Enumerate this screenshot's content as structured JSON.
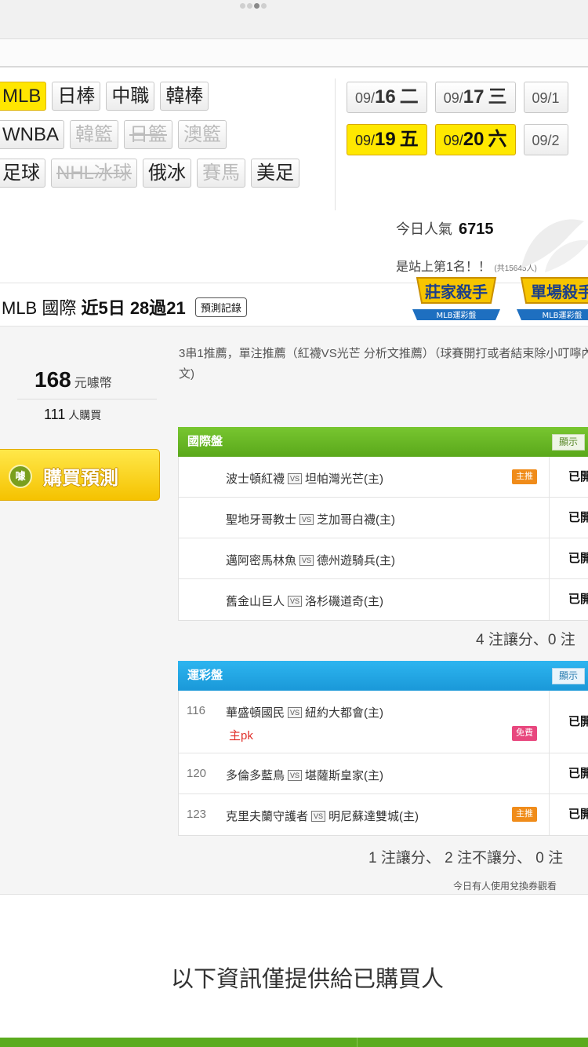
{
  "sport_tabs": {
    "row1": [
      {
        "label": "MLB",
        "state": "active"
      },
      {
        "label": "日棒",
        "state": "normal"
      },
      {
        "label": "中職",
        "state": "normal"
      },
      {
        "label": "韓棒",
        "state": "normal"
      }
    ],
    "row2": [
      {
        "label": "WNBA",
        "state": "normal"
      },
      {
        "label": "韓籃",
        "state": "disabled"
      },
      {
        "label": "日籃",
        "state": "strike"
      },
      {
        "label": "澳籃",
        "state": "disabled"
      }
    ],
    "row3": [
      {
        "label": "足球",
        "state": "normal"
      },
      {
        "label": "NHL冰球",
        "state": "strike"
      },
      {
        "label": "俄冰",
        "state": "normal"
      },
      {
        "label": "賽馬",
        "state": "disabled"
      },
      {
        "label": "美足",
        "state": "normal"
      }
    ]
  },
  "dates": {
    "row1": [
      {
        "md": "09/",
        "day": "16",
        "wd": "二",
        "active": false
      },
      {
        "md": "09/",
        "day": "17",
        "wd": "三",
        "active": false
      },
      {
        "md": "09/1",
        "day": "",
        "wd": "",
        "active": false
      }
    ],
    "row2": [
      {
        "md": "09/",
        "day": "19",
        "wd": "五",
        "active": true
      },
      {
        "md": "09/",
        "day": "20",
        "wd": "六",
        "active": true
      },
      {
        "md": "09/2",
        "day": "",
        "wd": "",
        "active": false
      }
    ]
  },
  "popularity": {
    "label": "今日人氣",
    "value": "6715"
  },
  "rank": {
    "text": "是站上第1名！！",
    "note": "(共15645人)"
  },
  "record": {
    "prefix": "MLB 國際 ",
    "bold": "近5日 28過21",
    "button": "預測記錄"
  },
  "badges": {
    "badge1_title": "莊家殺手",
    "badge1_sub": "MLB運彩盤",
    "badge2_title": "單場殺手",
    "badge2_sub": "MLB運彩盤"
  },
  "purchase": {
    "price": "168",
    "price_unit": "元噱幣",
    "buyers": "111",
    "buyers_unit": "人購買",
    "coin_label": "噱",
    "buy_button": "購買預測"
  },
  "description": "3串1推薦，單注推薦（紅襪VS光芒 分析文推薦）（球賽開打或者結束除小叮嚀內文)",
  "intl_table": {
    "title": "國際盤",
    "show_label": "顯示",
    "rows": [
      {
        "num": "",
        "away": "波士頓紅襪",
        "home": "坦帕灣光芒(主)",
        "sub": "",
        "tag": "主推",
        "tag_type": "main",
        "status": "已開"
      },
      {
        "num": "",
        "away": "聖地牙哥教士",
        "home": "芝加哥白襪(主)",
        "sub": "",
        "tag": "",
        "tag_type": "",
        "status": "已開"
      },
      {
        "num": "",
        "away": "邁阿密馬林魚",
        "home": "德州遊騎兵(主)",
        "sub": "",
        "tag": "",
        "tag_type": "",
        "status": "已開"
      },
      {
        "num": "",
        "away": "舊金山巨人",
        "home": "洛杉磯道奇(主)",
        "sub": "",
        "tag": "",
        "tag_type": "",
        "status": "已開"
      }
    ],
    "summary": "4 注讓分、0 注"
  },
  "sports_lottery_table": {
    "title": "運彩盤",
    "show_label": "顯示",
    "rows": [
      {
        "num": "116",
        "away": "華盛頓國民",
        "home": "紐約大都會(主)",
        "sub": "主pk",
        "tag": "免費",
        "tag_type": "free",
        "status": "已開"
      },
      {
        "num": "120",
        "away": "多倫多藍鳥",
        "home": "堪薩斯皇家(主)",
        "sub": "",
        "tag": "",
        "tag_type": "",
        "status": "已開"
      },
      {
        "num": "123",
        "away": "克里夫蘭守護者",
        "home": "明尼蘇達雙城(主)",
        "sub": "",
        "tag": "主推",
        "tag_type": "main",
        "status": "已開"
      }
    ],
    "summary": "1 注讓分、 2 注不讓分、 0 注"
  },
  "voucher_note": "今日有人使用兌換券觀看",
  "vs_label": "VS",
  "info_text": "以下資訊僅提供給已購買人",
  "colors": {
    "active_yellow": "#ffe600",
    "green_header": "#5aa81b",
    "blue_header": "#1a98d8",
    "tag_main": "#f08c1a",
    "tag_free": "#e8477e"
  }
}
